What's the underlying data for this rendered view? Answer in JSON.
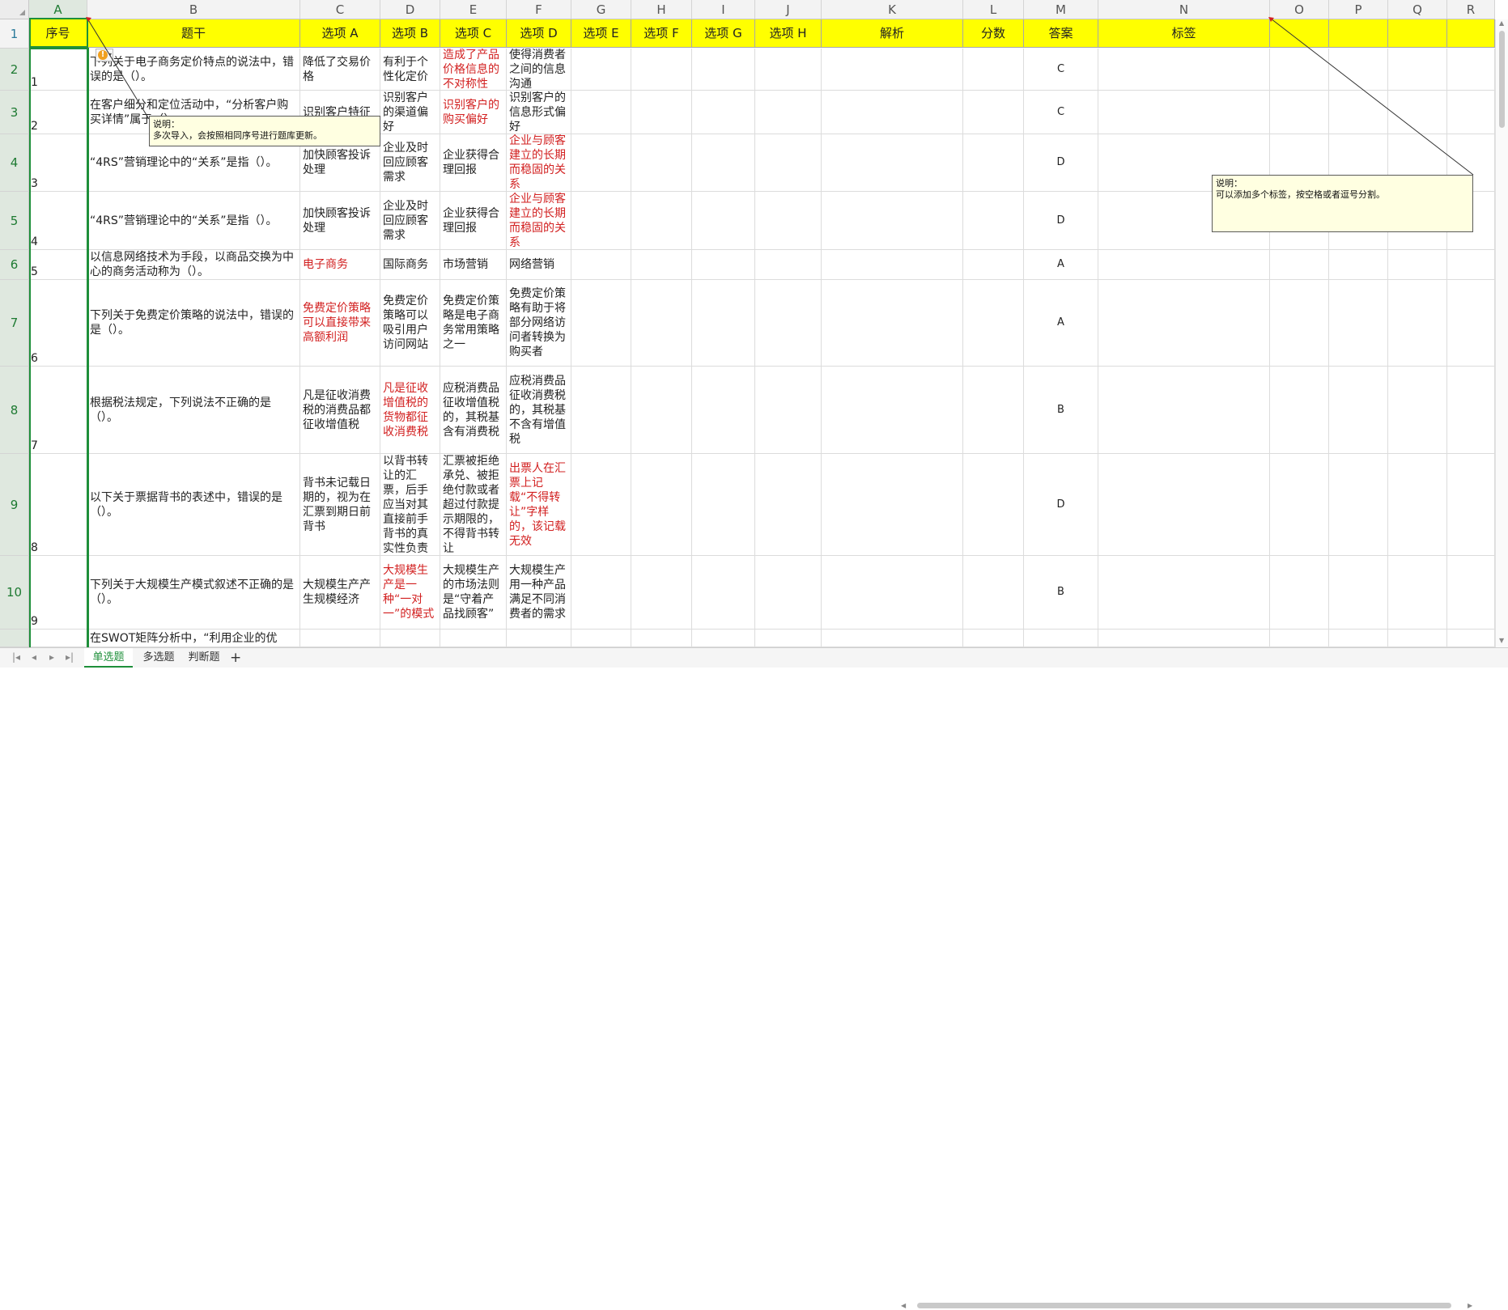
{
  "columns": [
    "A",
    "B",
    "C",
    "D",
    "E",
    "F",
    "G",
    "H",
    "I",
    "J",
    "K",
    "L",
    "M",
    "N",
    "O",
    "P",
    "Q",
    "R"
  ],
  "headers": {
    "A": "序号",
    "B": "题干",
    "C": "选项 A",
    "D": "选项 B",
    "E": "选项 C",
    "F": "选项 D",
    "G": "选项 E",
    "H": "选项 F",
    "I": "选项 G",
    "J": "选项 H",
    "K": "解析",
    "L": "分数",
    "M": "答案",
    "N": "标签"
  },
  "row_numbers": [
    "1",
    "2",
    "3",
    "4",
    "5",
    "6",
    "7",
    "8",
    "9",
    "10"
  ],
  "rows": [
    {
      "seq": "1",
      "stem": "下列关于电子商务定价特点的说法中，错误的是（）。",
      "a": "降低了交易价格",
      "b": "有利于个性化定价",
      "c": "造成了产品价格信息的不对称性",
      "d": "使得消费者之间的信息沟通",
      "answer": "C"
    },
    {
      "seq": "2",
      "stem": "在客户细分和定位活动中，“分析客户购买详情”属于（）。",
      "a": "识别客户特征",
      "b": "识别客户的渠道偏好",
      "c": "识别客户的购买偏好",
      "d": "识别客户的信息形式偏好",
      "answer": "C"
    },
    {
      "seq": "3",
      "stem": "“4RS”营销理论中的“关系”是指（）。",
      "a": "加快顾客投诉处理",
      "b": "企业及时回应顾客需求",
      "c": "企业获得合理回报",
      "d": "企业与顾客建立的长期而稳固的关系",
      "answer": "D"
    },
    {
      "seq": "4",
      "stem": "“4RS”营销理论中的“关系”是指（）。",
      "a": "加快顾客投诉处理",
      "b": "企业及时回应顾客需求",
      "c": "企业获得合理回报",
      "d": "企业与顾客建立的长期而稳固的关系",
      "answer": "D"
    },
    {
      "seq": "5",
      "stem": "以信息网络技术为手段，以商品交换为中心的商务活动称为（）。",
      "a": "电子商务",
      "b": "国际商务",
      "c": "市场营销",
      "d": "网络营销",
      "answer": "A"
    },
    {
      "seq": "6",
      "stem": "下列关于免费定价策略的说法中，错误的是（）。",
      "a": "免费定价策略可以直接带来高额利润",
      "b": "免费定价策略可以吸引用户访问网站",
      "c": "免费定价策略是电子商务常用策略之一",
      "d": "免费定价策略有助于将部分网络访问者转换为购买者",
      "answer": "A"
    },
    {
      "seq": "7",
      "stem": "根据税法规定，下列说法不正确的是（）。",
      "a": "凡是征收消费税的消费品都征收增值税",
      "b": "凡是征收增值税的货物都征收消费税",
      "c": "应税消费品征收增值税的，其税基含有消费税",
      "d": "应税消费品征收消费税的，其税基不含有增值税",
      "answer": "B"
    },
    {
      "seq": "8",
      "stem": "以下关于票据背书的表述中，错误的是（）。",
      "a": "背书未记载日期的，视为在汇票到期日前背书",
      "b": "以背书转让的汇票，后手应当对其直接前手背书的真实性负责",
      "c": "汇票被拒绝承兑、被拒绝付款或者超过付款提示期限的，不得背书转让",
      "d": "出票人在汇票上记载“不得转让”字样的，该记载无效",
      "answer": "D"
    },
    {
      "seq": "9",
      "stem": "下列关于大规模生产模式叙述不正确的是（）。",
      "a": "大规模生产产生规模经济",
      "b": "大规模生产是一种“一对一”的模式",
      "c": "大规模生产的市场法则是“守着产品找顾客”",
      "d": "大规模生产用一种产品满足不同消费者的需求",
      "answer": "B"
    },
    {
      "seq": "",
      "stem": "在SWOT矩阵分析中，“利用企业的优",
      "a": "",
      "b": "",
      "c": "",
      "d": "",
      "answer": ""
    }
  ],
  "comments": {
    "seq_note": {
      "title": "说明：",
      "body": "多次导入，会按照相同序号进行题库更新。"
    },
    "tag_note": {
      "title": "说明：",
      "body": "可以添加多个标签，按空格或者逗号分割。"
    }
  },
  "sheet_tabs": [
    "单选题",
    "多选题",
    "判断题"
  ],
  "active_tab": "单选题",
  "colors": {
    "header_fill": "#ffff00",
    "selection": "#1e8f3a",
    "correct_answer_text": "#d22020"
  }
}
